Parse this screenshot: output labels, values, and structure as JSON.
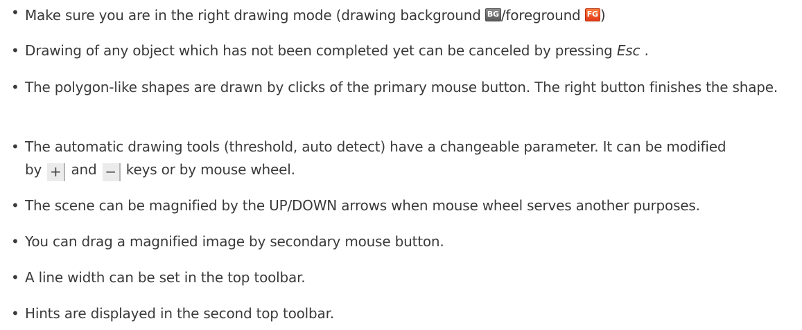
{
  "tips": [
    {
      "before": "Make sure you are in the right drawing mode (drawing background ",
      "bg_badge": "BG",
      "middle": "/foreground ",
      "fg_badge": "FG",
      "after": ")"
    },
    {
      "before": "Drawing of any object which has not been completed yet can be canceled by pressing ",
      "key": "Esc",
      "after": " ."
    },
    {
      "text": "The polygon-like shapes are drawn by clicks of the primary mouse button. The right button finishes the shape."
    },
    {
      "line1": "The automatic drawing tools (threshold, auto detect) have a changeable parameter. It can be modified",
      "by": "by ",
      "plus_key": "+",
      "and": " and ",
      "minus_key": "−",
      "rest": " keys or by mouse wheel."
    },
    {
      "text": "The scene can be magnified by the UP/DOWN arrows when mouse wheel serves another purposes."
    },
    {
      "text": "You can drag a magnified image by secondary mouse button."
    },
    {
      "text": "A line width can be set in the top toolbar."
    },
    {
      "text": "Hints are displayed in the second top toolbar."
    }
  ],
  "bullet_char": "•",
  "colors": {
    "text": "#3a3a3a",
    "bg_badge": "#6e6e6e",
    "fg_badge": "#f05a28",
    "key_background": "#ebebeb"
  },
  "icons": [
    "background-mode-icon",
    "foreground-mode-icon"
  ]
}
